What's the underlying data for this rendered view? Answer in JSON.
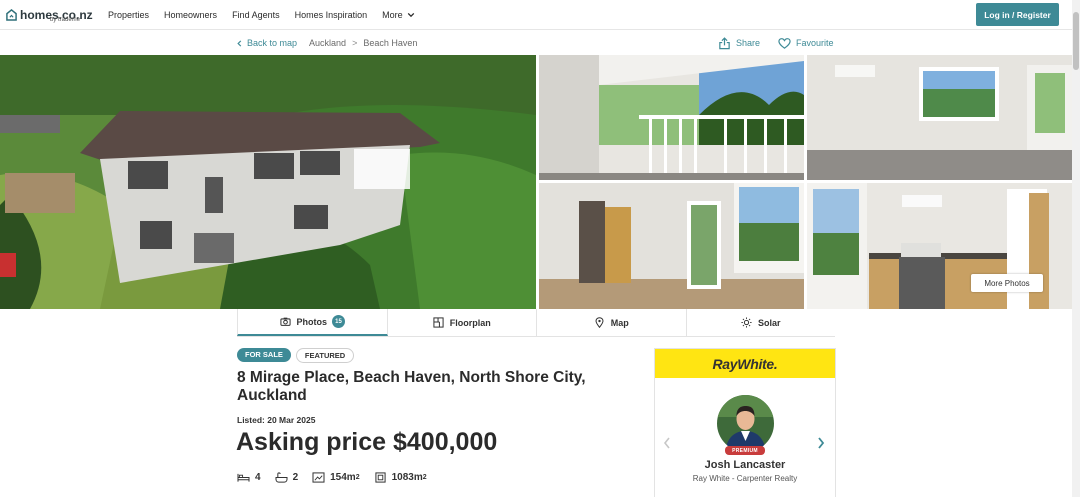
{
  "header": {
    "logo_text": "homes.co.nz",
    "logo_sub": "by trademe",
    "nav": [
      "Properties",
      "Homeowners",
      "Find Agents",
      "Homes Inspiration",
      "More"
    ],
    "login_label": "Log in / Register"
  },
  "breadcrumb": {
    "back_label": "Back to map",
    "items": [
      "Auckland",
      "Beach Haven"
    ],
    "separator": ">"
  },
  "actions": {
    "share_label": "Share",
    "favourite_label": "Favourite"
  },
  "gallery": {
    "more_photos_label": "More Photos"
  },
  "tabs": [
    {
      "label": "Photos",
      "icon": "camera-icon",
      "count": "15"
    },
    {
      "label": "Floorplan",
      "icon": "floorplan-icon"
    },
    {
      "label": "Map",
      "icon": "map-pin-icon"
    },
    {
      "label": "Solar",
      "icon": "sun-icon"
    }
  ],
  "listing": {
    "status_badge": "FOR SALE",
    "featured_badge": "FEATURED",
    "address": "8 Mirage Place, Beach Haven, North Shore City, Auckland",
    "listed_date": "Listed: 20 Mar 2025",
    "price": "Asking price $400,000",
    "bedrooms": "4",
    "bathrooms": "2",
    "floor_area": "154m",
    "land_area": "1083m",
    "area_unit_sup": "2"
  },
  "agent": {
    "agency": "RayWhite.",
    "premium_label": "PREMIUM",
    "name": "Josh Lancaster",
    "office": "Ray White - Carpenter Realty"
  },
  "colors": {
    "accent": "#3e8a96",
    "agency_yellow": "#ffe512",
    "premium_red": "#c83c3c"
  }
}
